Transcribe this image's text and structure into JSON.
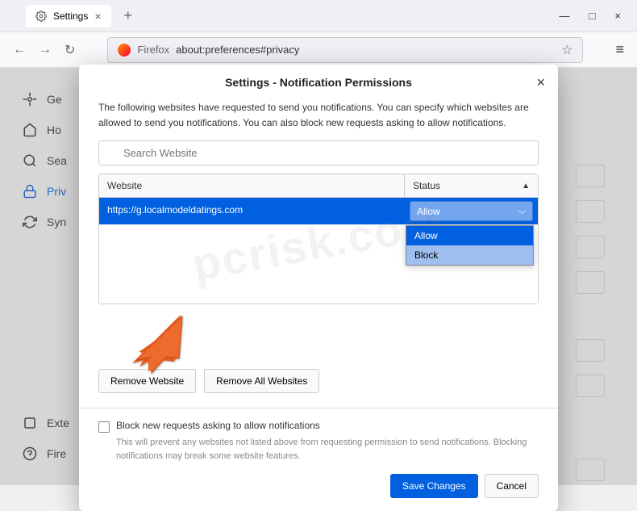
{
  "tab": {
    "title": "Settings"
  },
  "urlbar": {
    "prefix": "Firefox",
    "url": "about:preferences#privacy"
  },
  "sidebar": {
    "items": [
      {
        "label": "Ge",
        "icon": "gear"
      },
      {
        "label": "Ho",
        "icon": "home"
      },
      {
        "label": "Sea",
        "icon": "search"
      },
      {
        "label": "Priv",
        "icon": "lock",
        "active": true
      },
      {
        "label": "Syn",
        "icon": "sync"
      }
    ],
    "bottom": [
      {
        "label": "Exte",
        "icon": "puzzle"
      },
      {
        "label": "Fire",
        "icon": "help"
      }
    ]
  },
  "modal": {
    "title": "Settings - Notification Permissions",
    "description": "The following websites have requested to send you notifications. You can specify which websites are allowed to send you notifications. You can also block new requests asking to allow notifications.",
    "search_placeholder": "Search Website",
    "columns": {
      "website": "Website",
      "status": "Status"
    },
    "row": {
      "url": "https://g.localmodeldatings.com",
      "status": "Allow"
    },
    "dropdown": {
      "allow": "Allow",
      "block": "Block"
    },
    "remove_website": "Remove Website",
    "remove_all": "Remove All Websites",
    "block_new_label": "Block new requests asking to allow notifications",
    "block_new_desc": "This will prevent any websites not listed above from requesting permission to send notifications. Blocking notifications may break some website features.",
    "save": "Save Changes",
    "cancel": "Cancel"
  },
  "watermark": "pcrisk.com"
}
